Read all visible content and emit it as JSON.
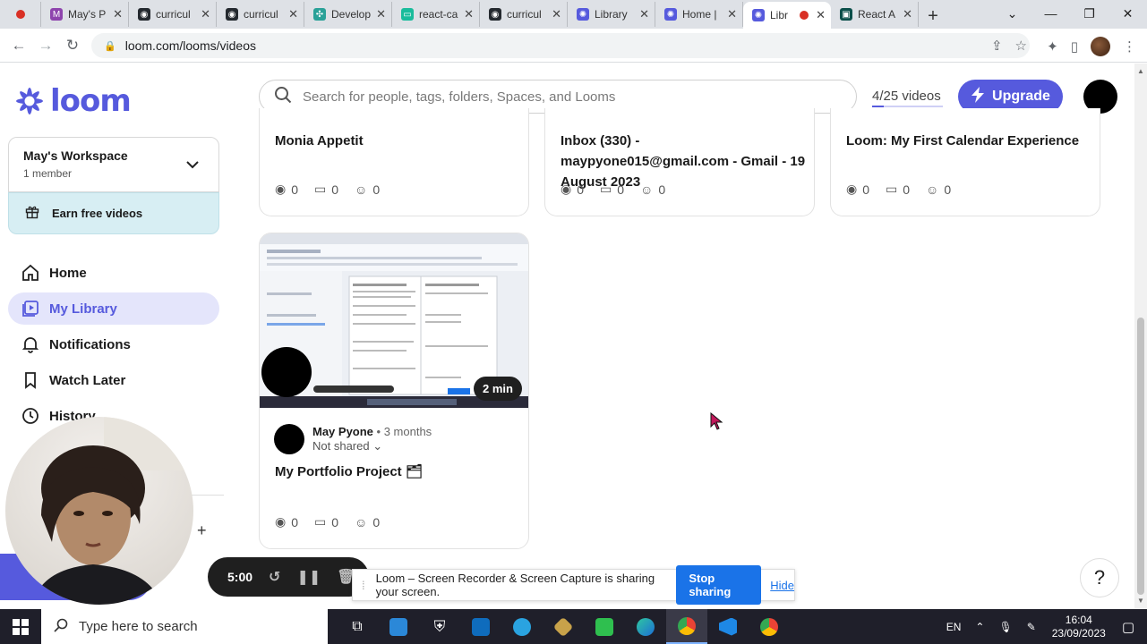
{
  "browser": {
    "tabs": [
      {
        "title": "May's P",
        "color": "#8e44ad",
        "glyph": "M",
        "active": false
      },
      {
        "title": "curricul",
        "color": "#24292f",
        "glyph": "◉",
        "active": false
      },
      {
        "title": "curricul",
        "color": "#24292f",
        "glyph": "◉",
        "active": false
      },
      {
        "title": "Develop",
        "color": "#2aa198",
        "glyph": "✣",
        "active": false
      },
      {
        "title": "react-ca",
        "color": "#1abc9c",
        "glyph": "▭",
        "active": false
      },
      {
        "title": "curricul",
        "color": "#24292f",
        "glyph": "◉",
        "active": false
      },
      {
        "title": "Library",
        "color": "#565add",
        "glyph": "✺",
        "active": false
      },
      {
        "title": "Home |",
        "color": "#565add",
        "glyph": "✺",
        "active": false
      },
      {
        "title": "Libr",
        "color": "#565add",
        "glyph": "✺",
        "active": true
      },
      {
        "title": "React A",
        "color": "#0b4f4a",
        "glyph": "▣",
        "active": false
      }
    ],
    "url": "loom.com/looms/videos"
  },
  "sidebar": {
    "logo_text": "loom",
    "workspace": {
      "name": "May's Workspace",
      "members": "1 member"
    },
    "earn_label": "Earn free videos",
    "nav": [
      {
        "key": "home",
        "label": "Home",
        "icon": "home-icon",
        "active": false
      },
      {
        "key": "library",
        "label": "My Library",
        "icon": "library-icon",
        "active": true
      },
      {
        "key": "notifications",
        "label": "Notifications",
        "icon": "bell-icon",
        "active": false
      },
      {
        "key": "watch-later",
        "label": "Watch Later",
        "icon": "bookmark-icon",
        "active": false
      },
      {
        "key": "history",
        "label": "History",
        "icon": "clock-icon",
        "active": false
      }
    ]
  },
  "header": {
    "search_placeholder": "Search for people, tags, folders, Spaces, and Looms",
    "video_count": "4/25 videos",
    "video_fraction": 0.16,
    "upgrade_label": "Upgrade"
  },
  "videos": [
    {
      "title": "Monia Appetit",
      "views": "0",
      "comments": "0",
      "reactions": "0"
    },
    {
      "title": "Inbox (330) - maypyone015@gmail.com - Gmail - 19 August 2023",
      "views": "0",
      "comments": "0",
      "reactions": "0"
    },
    {
      "title": "Loom: My First Calendar Experience",
      "views": "0",
      "comments": "0",
      "reactions": "0"
    },
    {
      "title": "My Portfolio Project 🗂",
      "views": "0",
      "comments": "0",
      "reactions": "0",
      "duration": "2 min",
      "owner": "May Pyone",
      "age": "• 3 months",
      "sharing": "Not shared ⌄"
    }
  ],
  "recorder": {
    "timer": "5:00",
    "share_message": "Loom – Screen Recorder & Screen Capture is sharing your screen.",
    "stop_label": "Stop sharing",
    "hide_label": "Hide"
  },
  "help_label": "?",
  "taskbar": {
    "search_placeholder": "Type here to search",
    "lang": "EN",
    "time": "16:04",
    "date": "23/09/2023"
  },
  "colors": {
    "brand": "#565add",
    "brand_light": "#e4e5fb",
    "earn_bg": "#d7eef3",
    "share_blue": "#1a73e8"
  }
}
